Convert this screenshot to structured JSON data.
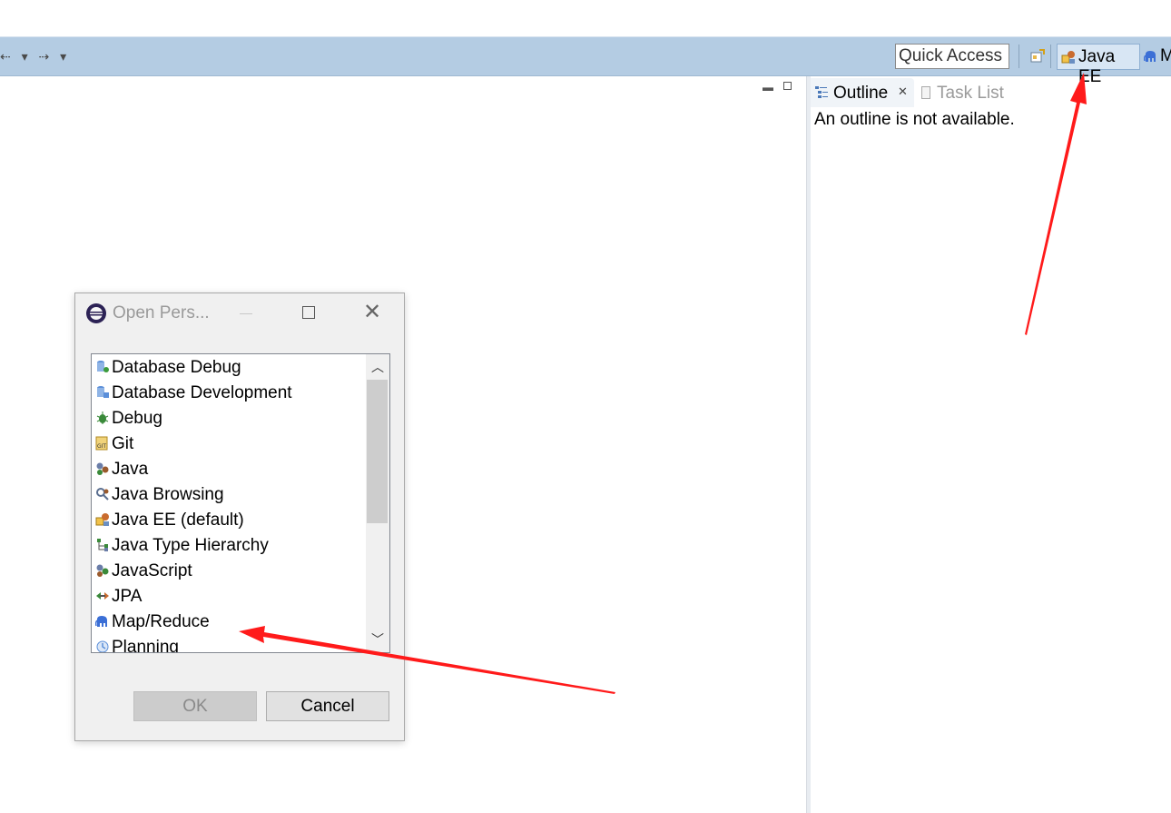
{
  "toolbar": {
    "nav_icons": [
      "back-arrow",
      "dropdown",
      "forward-arrow",
      "dropdown"
    ],
    "quick_access_placeholder": "Quick Access",
    "perspectives": [
      {
        "label": "Java EE",
        "icon": "java-ee-perspective-icon",
        "active": true
      },
      {
        "label": "M",
        "icon": "map-reduce-elephant-icon",
        "active": false
      }
    ]
  },
  "views": {
    "tabs": [
      {
        "label": "Outline",
        "active": true,
        "close": "✕"
      },
      {
        "label": "Task List",
        "active": false
      }
    ],
    "outline_message": "An outline is not available."
  },
  "dialog": {
    "title": "Open Pers...",
    "items": [
      {
        "label": "Database Debug",
        "icon": "database-debug-icon"
      },
      {
        "label": "Database Development",
        "icon": "database-development-icon"
      },
      {
        "label": "Debug",
        "icon": "debug-bug-icon"
      },
      {
        "label": "Git",
        "icon": "git-icon"
      },
      {
        "label": "Java",
        "icon": "java-icon"
      },
      {
        "label": "Java Browsing",
        "icon": "java-browsing-icon"
      },
      {
        "label": "Java EE (default)",
        "icon": "java-ee-icon"
      },
      {
        "label": "Java Type Hierarchy",
        "icon": "type-hierarchy-icon"
      },
      {
        "label": "JavaScript",
        "icon": "javascript-icon"
      },
      {
        "label": "JPA",
        "icon": "jpa-icon"
      },
      {
        "label": "Map/Reduce",
        "icon": "map-reduce-elephant-icon"
      },
      {
        "label": "Planning",
        "icon": "planning-icon"
      }
    ],
    "ok_label": "OK",
    "cancel_label": "Cancel"
  },
  "colors": {
    "toolbar_bg": "#b4cce3",
    "annotation_arrow": "#ff1a1a"
  }
}
